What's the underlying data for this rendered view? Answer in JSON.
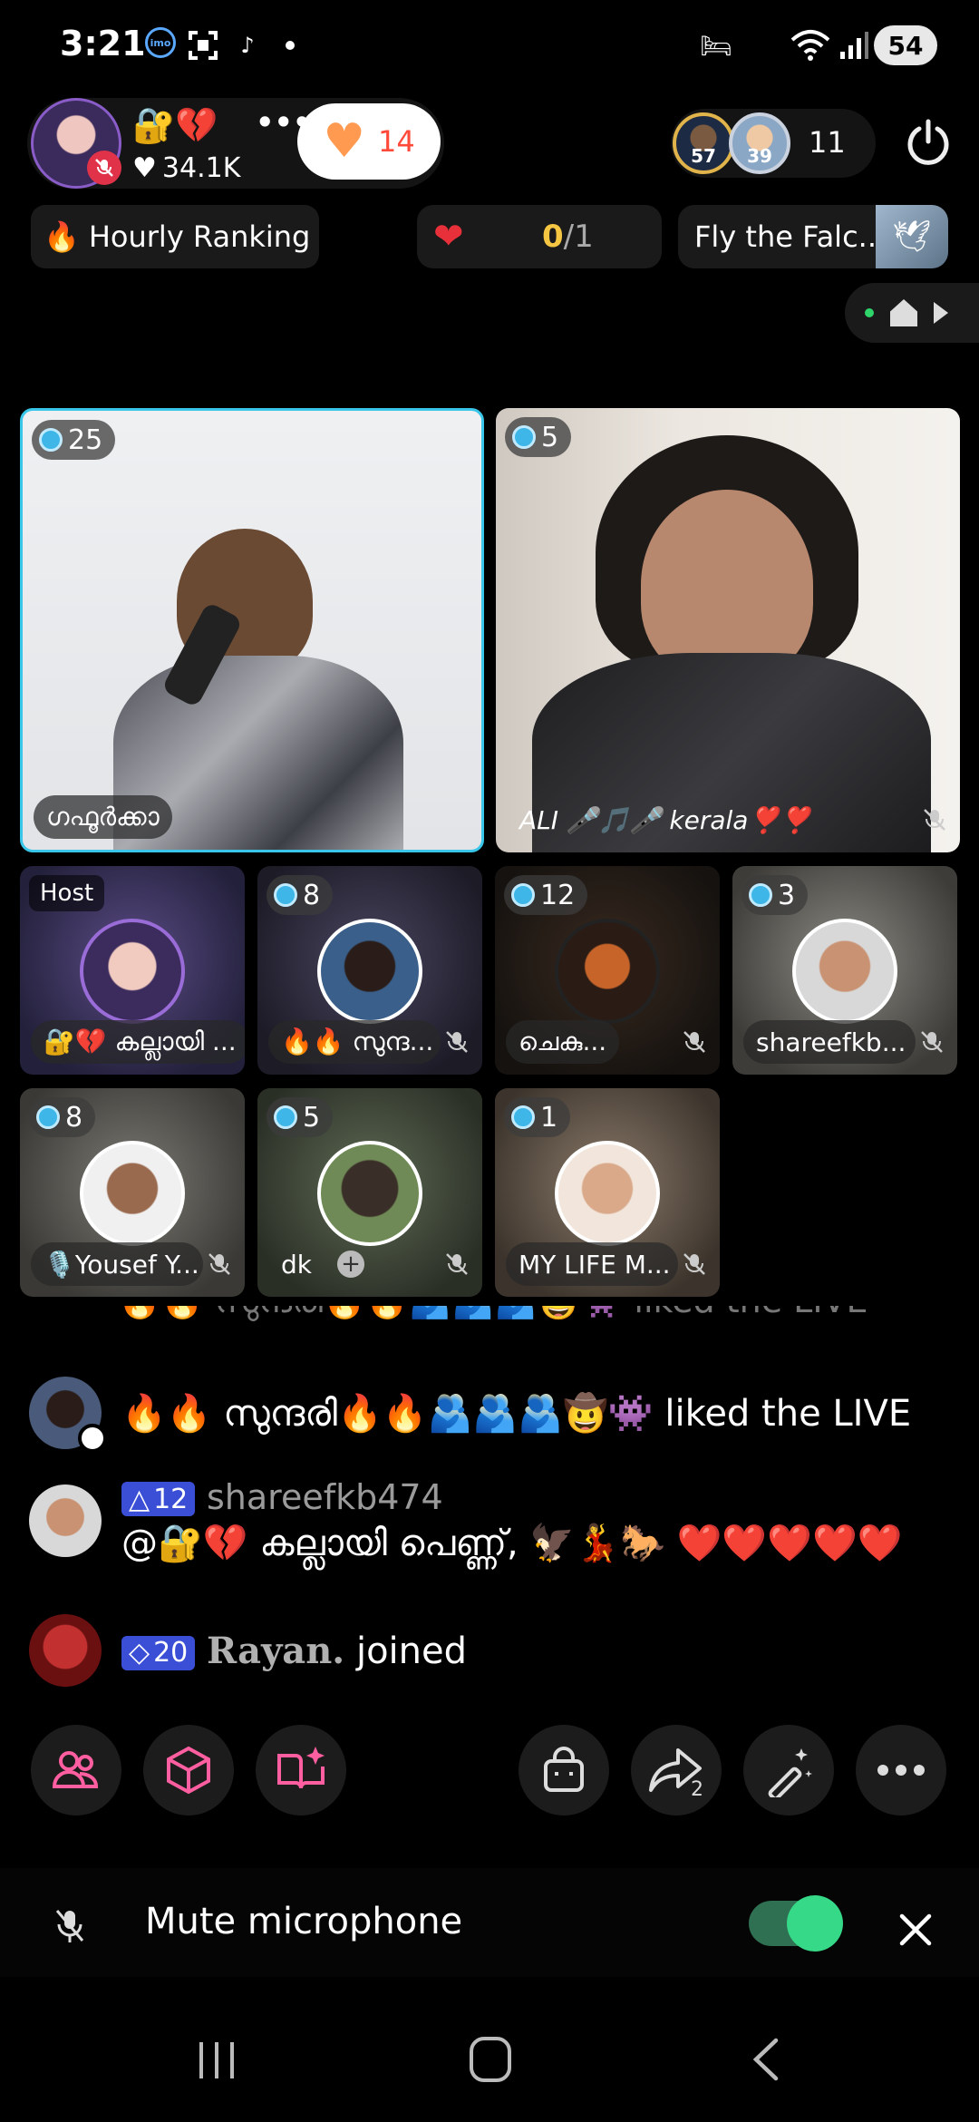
{
  "status_bar": {
    "time": "3:21",
    "battery": "54",
    "imo_label": "imo"
  },
  "host": {
    "badge_emoji": "🔐💔",
    "more": "•••",
    "likes": "34.1K",
    "heart_count": "14"
  },
  "viewers": {
    "avatar1_level": "57",
    "avatar2_level": "39",
    "count": "11"
  },
  "ranking": {
    "label": "Hourly Ranking",
    "icon": "👆"
  },
  "goal": {
    "current": "0",
    "total": "/1"
  },
  "event": {
    "label": "Fly the Falc..."
  },
  "seats": {
    "main": [
      {
        "level": "25",
        "name": "ഗഫൂർക്കാ"
      },
      {
        "level": "5",
        "name": "ALI 🎤🎵🎤 kerala❣️❣️"
      }
    ],
    "grid": [
      {
        "host_tag": "Host",
        "name": "🔐💔 കല്ലായി ..."
      },
      {
        "level": "8",
        "name": "🔥🔥 സുന്ദ..."
      },
      {
        "level": "12",
        "name": "ചെകു..."
      },
      {
        "level": "3",
        "name": "shareefkb..."
      },
      {
        "level": "8",
        "name": "🎙️Yousef Y..."
      },
      {
        "level": "5",
        "name": "dk"
      },
      {
        "level": "1",
        "name": "MY LIFE M..."
      }
    ]
  },
  "chat": {
    "faded": "🔥🔥 സുന്ദരി🔥🔥🫂🫂🫂🤠👾 liked the LIVE",
    "messages": [
      {
        "text": "🔥🔥 സുന്ദരി🔥🔥🫂🫂🫂🤠👾 liked the LIVE"
      },
      {
        "badge": "12",
        "user": "shareefkb474",
        "text": "@🔐💔 കല്ലായി പെണ്ണ്, 🦅💃🐎 ❤️❤️❤️❤️❤️"
      },
      {
        "badge": "20",
        "user": "Rayan.",
        "text": "joined"
      }
    ]
  },
  "toolbar": {
    "share_count": "2"
  },
  "mute": {
    "label": "Mute microphone",
    "enabled": true
  },
  "colors": {
    "accent_cyan": "#39c6e8",
    "toggle_green": "#35d987",
    "badge_blue": "#3a4fd6",
    "heart_red": "#e8303a"
  }
}
